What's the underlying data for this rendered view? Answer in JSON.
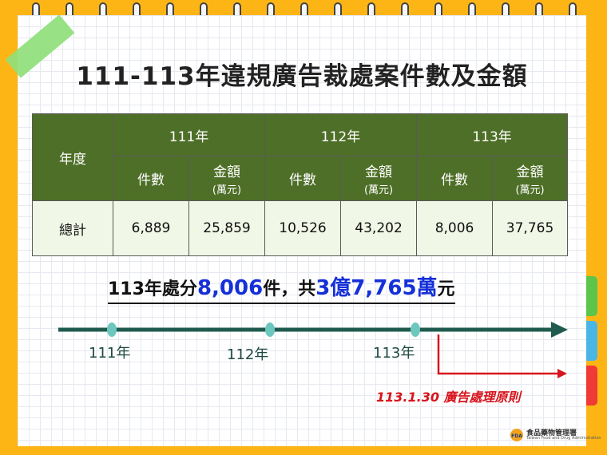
{
  "slide": {
    "title": "111-113年違規廣告裁處案件數及金額"
  },
  "table": {
    "corner_label": "年度",
    "years": [
      "111年",
      "112年",
      "113年"
    ],
    "count_label": "件數",
    "amount_label": "金額",
    "amount_unit": "(萬元)",
    "row_label": "總計",
    "rows": [
      {
        "count": "6,889",
        "amount": "25,859"
      },
      {
        "count": "10,526",
        "amount": "43,202"
      },
      {
        "count": "8,006",
        "amount": "37,765"
      }
    ]
  },
  "summary": {
    "prefix": "113年處分",
    "count": "8,006",
    "mid": "件，共",
    "amount": "3億7,765萬",
    "suffix": "元"
  },
  "timeline": {
    "labels": [
      "111年",
      "112年",
      "113年"
    ],
    "event_label": "113.1.30 廣告處理原則"
  },
  "logo": {
    "name_cn": "食品藥物管理署",
    "name_en": "Taiwan Food and Drug Administration",
    "mark": "FDA"
  },
  "colors": {
    "background": "#FDB515",
    "table_header": "#4e6f27",
    "table_body": "#f1f7e6",
    "timeline": "#1f5a4f",
    "timeline_dot": "#6cc7bf",
    "highlight": "#1530d8",
    "event": "#d8141c",
    "tab_green": "#5cc54a",
    "tab_blue": "#4ab6e6",
    "tab_red": "#ef3a35"
  }
}
